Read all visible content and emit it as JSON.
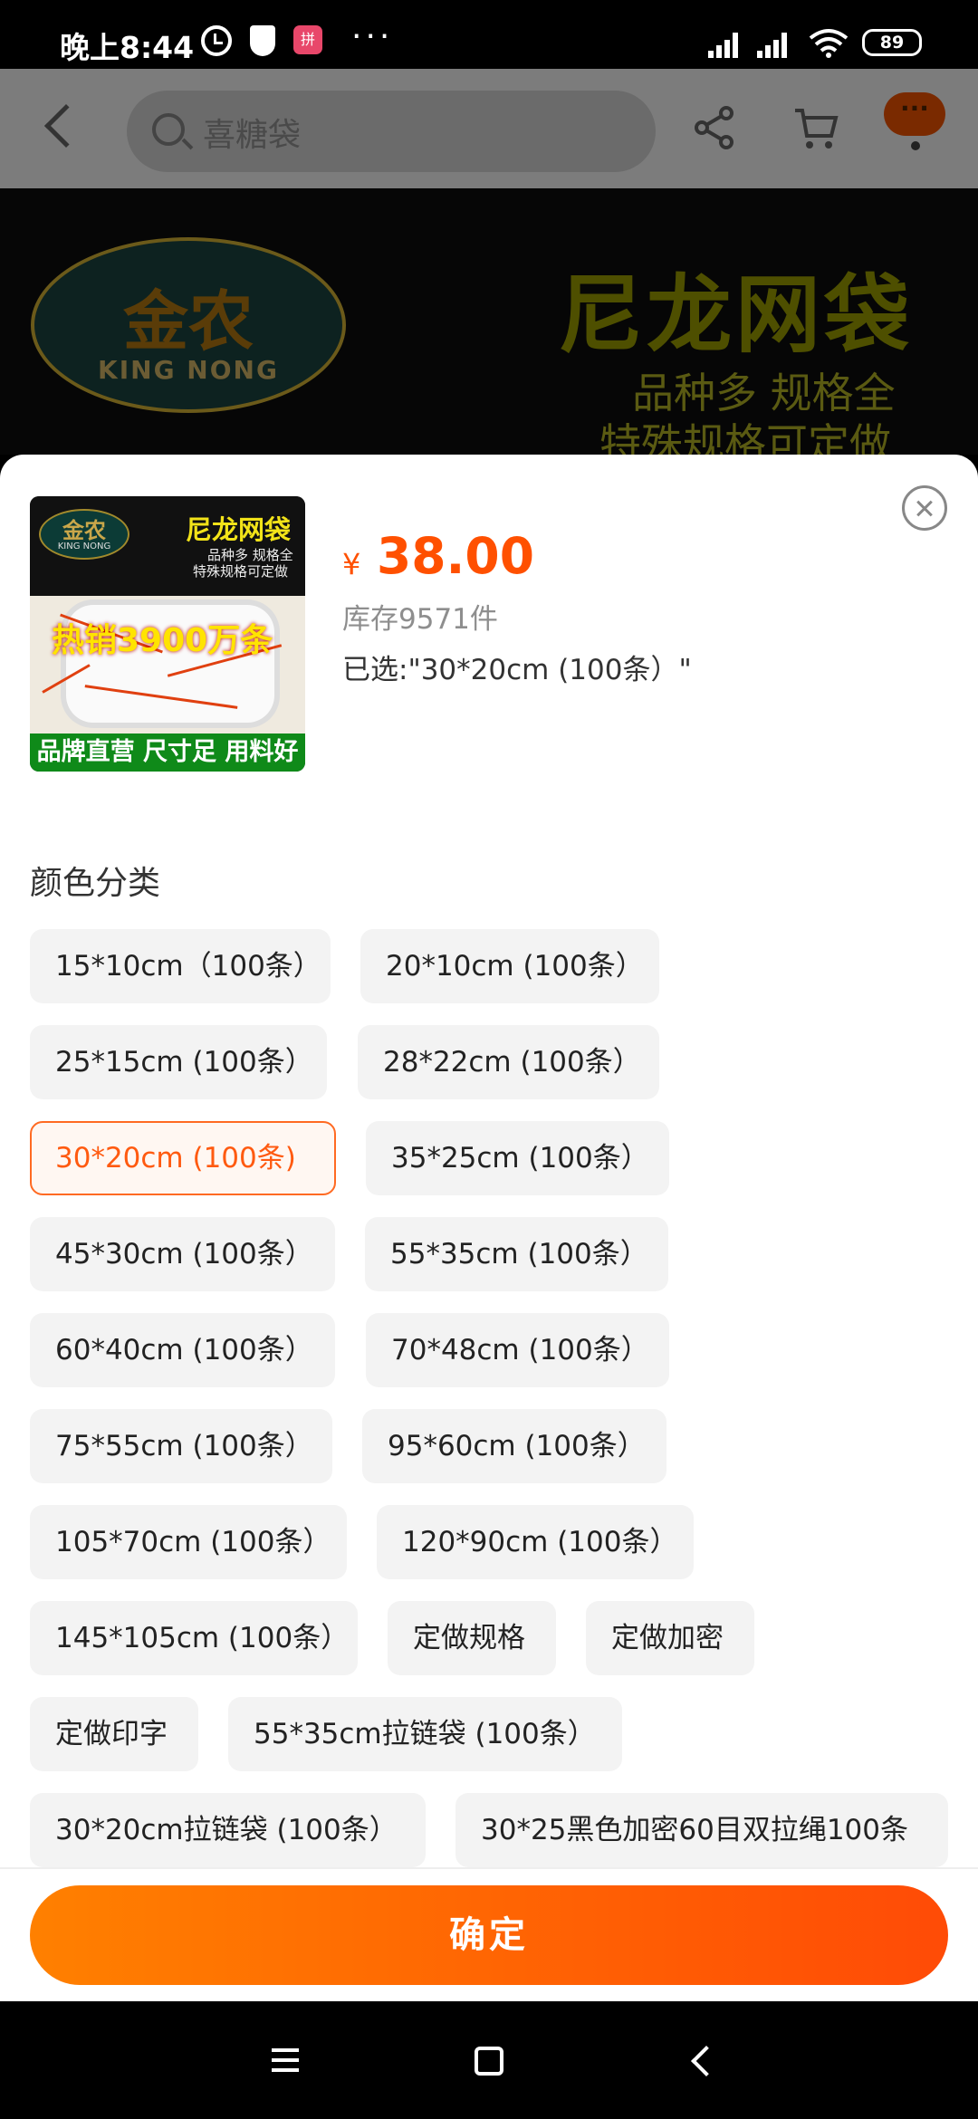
{
  "status_bar": {
    "time": "晚上8:44",
    "app_icon_label": "拼",
    "more": "···",
    "battery": "89"
  },
  "search": {
    "placeholder": "喜糖袋"
  },
  "nav": {
    "more_label": "···"
  },
  "banner": {
    "logo_cn": "金农",
    "logo_en": "KING NONG",
    "title": "尼龙网袋",
    "line1": "品种多 规格全",
    "line2": "特殊规格可定做"
  },
  "product": {
    "thumb": {
      "logo_cn": "金农",
      "logo_en": "KING NONG",
      "title": "尼龙网袋",
      "sub1": "品种多 规格全",
      "sub2": "特殊规格可定做",
      "hot": "热销3900万条",
      "bottom": "品牌直营 尺寸足 用料好"
    },
    "currency": "¥",
    "price": "38.00",
    "stock": "库存9571件",
    "selected": "已选:\"30*20cm (100条）\""
  },
  "section_title": "颜色分类",
  "options": [
    {
      "label": "15*10cm（100条）",
      "selected": false
    },
    {
      "label": "20*10cm (100条）",
      "selected": false
    },
    {
      "label": "25*15cm (100条）",
      "selected": false
    },
    {
      "label": "28*22cm (100条）",
      "selected": false
    },
    {
      "label": "30*20cm (100条)",
      "selected": true
    },
    {
      "label": "35*25cm (100条）",
      "selected": false
    },
    {
      "label": "45*30cm (100条）",
      "selected": false
    },
    {
      "label": "55*35cm (100条）",
      "selected": false
    },
    {
      "label": "60*40cm (100条）",
      "selected": false
    },
    {
      "label": "70*48cm (100条）",
      "selected": false
    },
    {
      "label": "75*55cm (100条）",
      "selected": false
    },
    {
      "label": "95*60cm (100条）",
      "selected": false
    },
    {
      "label": "105*70cm (100条）",
      "selected": false
    },
    {
      "label": "120*90cm (100条）",
      "selected": false
    },
    {
      "label": "145*105cm (100条）",
      "selected": false
    },
    {
      "label": "定做规格",
      "selected": false
    },
    {
      "label": "定做加密",
      "selected": false
    },
    {
      "label": "定做印字",
      "selected": false
    },
    {
      "label": "55*35cm拉链袋 (100条）",
      "selected": false
    },
    {
      "label": "30*20cm拉链袋 (100条）",
      "selected": false
    },
    {
      "label": "30*25黑色加密60目双拉绳100条",
      "selected": false
    }
  ],
  "confirm_label": "确定",
  "colors": {
    "accent": "#ff5000",
    "confirm_start": "#ff8000",
    "confirm_end": "#ff4b06",
    "option_bg": "#f3f3f3"
  }
}
